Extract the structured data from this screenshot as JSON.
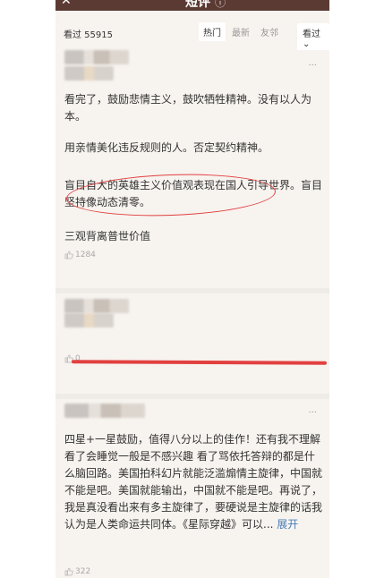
{
  "header": {
    "close_icon": "close-icon",
    "title": "短评",
    "info_icon": "info-icon"
  },
  "filters": {
    "count_label": "看过 55915",
    "tabs": [
      {
        "label": "热门",
        "active": true
      },
      {
        "label": "最新",
        "active": false
      },
      {
        "label": "友邻",
        "active": false
      }
    ],
    "dropdown_label": "看过",
    "dropdown_arrow": "chevron-down-icon"
  },
  "reviews": [
    {
      "paragraphs": [
        "看完了，鼓励悲情主义，鼓吹牺牲精神。没有以人为本。",
        "用亲情美化违反规则的人。否定契约精神。",
        "盲目自大的英雄主义价值观表现在国人引导世界。盲目坚持像动态清零。",
        "三观背离普世价值"
      ],
      "likes": "1284",
      "more": "···"
    },
    {
      "paragraphs": [],
      "likes": "0",
      "more": "···"
    },
    {
      "paragraphs": [
        "四星+一星鼓励，值得八分以上的佳作！还有我不理解 看了会睡觉一般是不感兴趣 看了骂依托答辩的都是什么脑回路。美国拍科幻片就能泛滥煽情主旋律，中国就不能是吧。美国就能输出，中国就不能是吧。再说了，我是真没看出来有多主旋律了，要硬说是主旋律的话我认为是人类命运共同体。《星际穿越》可以... "
      ],
      "expand": "展开",
      "likes": "322",
      "more": "···"
    }
  ],
  "colors": {
    "annotation": "#e1403f",
    "header_bg": "#5b3a33",
    "background": "#f7f3ef"
  }
}
